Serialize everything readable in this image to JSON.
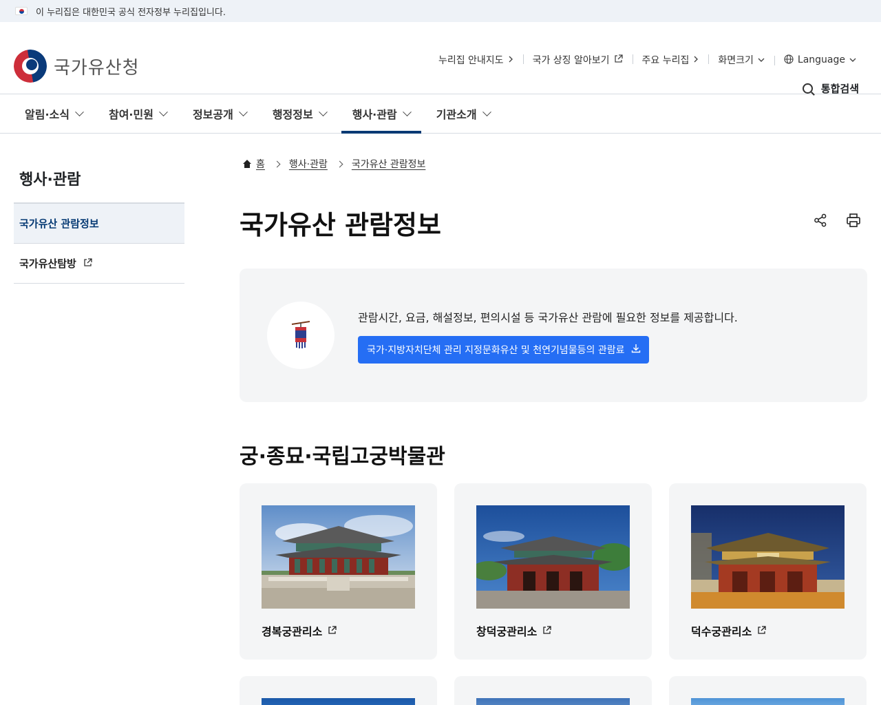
{
  "gov_banner": {
    "text": "이 누리집은 대한민국 공식 전자정부 누리집입니다."
  },
  "logo": {
    "text": "국가유산청"
  },
  "util_nav": [
    {
      "label": "누리집 안내지도",
      "icon": "chevron-right-icon"
    },
    {
      "label": "국가 상징 알아보기",
      "icon": "external-link-icon"
    },
    {
      "label": "주요 누리집",
      "icon": "chevron-right-icon"
    },
    {
      "label": "화면크기",
      "icon": "chevron-down-icon"
    },
    {
      "label": "Language",
      "icon": "chevron-down-icon"
    }
  ],
  "search": {
    "label": "통합검색"
  },
  "gnb": [
    {
      "label": "알림·소식"
    },
    {
      "label": "참여·민원"
    },
    {
      "label": "정보공개"
    },
    {
      "label": "행정정보"
    },
    {
      "label": "행사·관람",
      "active": true
    },
    {
      "label": "기관소개"
    }
  ],
  "sidebar": {
    "title": "행사·관람",
    "items": [
      {
        "label": "국가유산 관람정보",
        "active": true
      },
      {
        "label": "국가유산탐방",
        "external": true
      }
    ]
  },
  "breadcrumb": {
    "home": "홈",
    "level1": "행사·관람",
    "level2": "국가유산 관람정보"
  },
  "page": {
    "title": "국가유산 관람정보"
  },
  "info": {
    "text": "관람시간, 요금, 해설정보, 편의시설 등 국가유산 관람에 필요한 정보를 제공합니다.",
    "button": "국가·지방자치단체 관리 지정문화유산 및 천연기념물등의 관람료"
  },
  "section": {
    "title": "궁·종묘·국립고궁박물관"
  },
  "cards": [
    {
      "label": "경복궁관리소"
    },
    {
      "label": "창덕궁관리소"
    },
    {
      "label": "덕수궁관리소"
    }
  ],
  "colors": {
    "primary": "#063a74",
    "button": "#256ef4",
    "box_bg": "#f4f5f6",
    "banner_bg": "#eef2f7"
  }
}
